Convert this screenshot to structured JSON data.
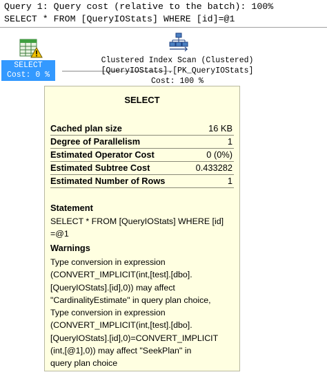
{
  "header": {
    "line1": "Query 1: Query cost (relative to the batch): 100%",
    "line2": "SELECT * FROM [QueryIOStats] WHERE [id]=@1"
  },
  "plan": {
    "select_node": {
      "label_line1": "SELECT",
      "label_line2": "Cost: 0 %",
      "icon": "select-operator-icon",
      "warning_icon": "warning-icon"
    },
    "scan_node": {
      "icon": "clustered-index-scan-icon",
      "line1": "Clustered Index Scan (Clustered)",
      "line2": "[QueryIOStats].[PK_QueryIOStats]",
      "line3": "Cost: 100 %"
    }
  },
  "tooltip": {
    "title": "SELECT",
    "properties": [
      {
        "key": "Cached plan size",
        "value": "16 KB"
      },
      {
        "key": "Degree of Parallelism",
        "value": "1"
      },
      {
        "key": "Estimated Operator Cost",
        "value": "0 (0%)"
      },
      {
        "key": "Estimated Subtree Cost",
        "value": "0.433282"
      },
      {
        "key": "Estimated Number of Rows",
        "value": "1"
      }
    ],
    "statement_title": "Statement",
    "statement": "SELECT * FROM [QueryIOStats] WHERE [id]\n=@1",
    "warnings_title": "Warnings",
    "warnings": "Type conversion in expression\n(CONVERT_IMPLICIT(int,[test].[dbo].\n[QueryIOStats].[id],0)) may affect\n\"CardinalityEstimate\" in query plan choice,\nType conversion in expression\n(CONVERT_IMPLICIT(int,[test].[dbo].\n[QueryIOStats].[id],0)=CONVERT_IMPLICIT\n(int,[@1],0)) may affect \"SeekPlan\" in\nquery plan choice"
  },
  "colors": {
    "selection": "#3399ff",
    "tooltip_bg": "#ffffe1",
    "warning": "#f2c200"
  }
}
